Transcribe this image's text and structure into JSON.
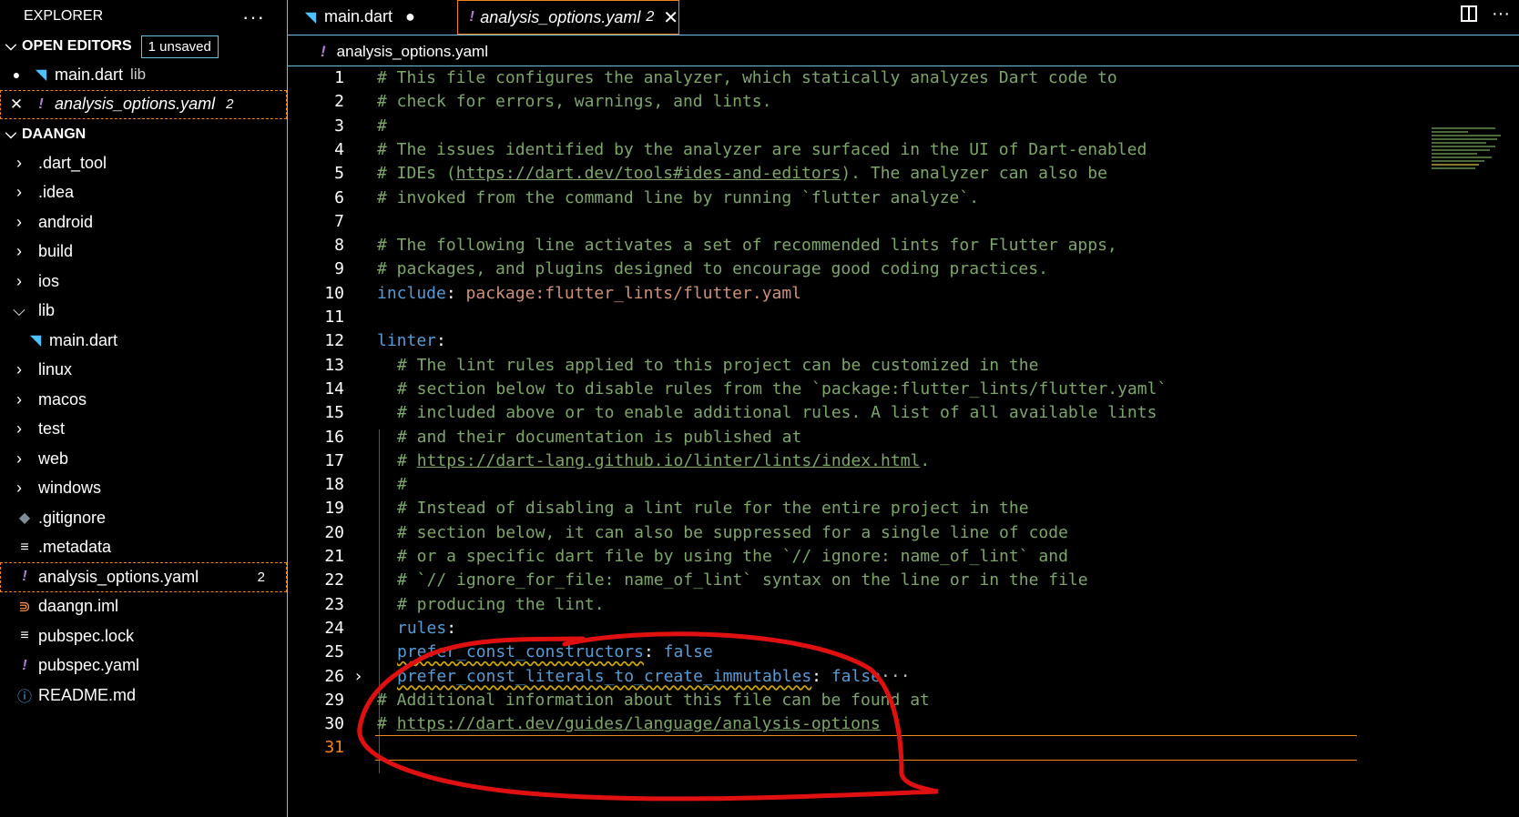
{
  "explorer": {
    "title": "EXPLORER",
    "more": "···",
    "open_editors": {
      "label": "OPEN EDITORS",
      "badge": "1 unsaved",
      "items": [
        {
          "name": "main.dart",
          "desc": "lib",
          "status": "●"
        },
        {
          "name": "analysis_options.yaml",
          "count": "2",
          "status": "✕"
        }
      ]
    },
    "project": {
      "label": "DAANGN",
      "items": [
        {
          "name": ".dart_tool"
        },
        {
          "name": ".idea"
        },
        {
          "name": "android"
        },
        {
          "name": "build"
        },
        {
          "name": "ios"
        },
        {
          "name": "lib"
        },
        {
          "name": "main.dart"
        },
        {
          "name": "linux"
        },
        {
          "name": "macos"
        },
        {
          "name": "test"
        },
        {
          "name": "web"
        },
        {
          "name": "windows"
        },
        {
          "name": ".gitignore"
        },
        {
          "name": ".metadata"
        },
        {
          "name": "analysis_options.yaml",
          "count": "2"
        },
        {
          "name": "daangn.iml"
        },
        {
          "name": "pubspec.lock"
        },
        {
          "name": "pubspec.yaml"
        },
        {
          "name": "README.md"
        }
      ]
    }
  },
  "tabs": [
    {
      "label": "main.dart",
      "modified": "●"
    },
    {
      "label": "analysis_options.yaml",
      "count": "2",
      "close": "✕"
    }
  ],
  "breadcrumb": {
    "file": "analysis_options.yaml"
  },
  "editor": {
    "line_numbers": [
      "1",
      "2",
      "3",
      "4",
      "5",
      "6",
      "7",
      "8",
      "9",
      "10",
      "11",
      "12",
      "13",
      "14",
      "15",
      "16",
      "17",
      "18",
      "19",
      "20",
      "21",
      "22",
      "23",
      "24",
      "25",
      "26",
      "29",
      "30",
      "31"
    ],
    "lines": {
      "l1": "# This file configures the analyzer, which statically analyzes Dart code to",
      "l2": "# check for errors, warnings, and lints.",
      "l3": "#",
      "l4": "# The issues identified by the analyzer are surfaced in the UI of Dart-enabled",
      "l5a": "# IDEs (",
      "l5url": "https://dart.dev/tools#ides-and-editors",
      "l5b": "). The analyzer can also be",
      "l6": "# invoked from the command line by running `flutter analyze`.",
      "l8": "# The following line activates a set of recommended lints for Flutter apps,",
      "l9": "# packages, and plugins designed to encourage good coding practices.",
      "l10key": "include",
      "l10val": "package:flutter_lints/flutter.yaml",
      "l12key": "linter",
      "l13": "# The lint rules applied to this project can be customized in the",
      "l14": "# section below to disable rules from the `package:flutter_lints/flutter.yaml`",
      "l15": "# included above or to enable additional rules. A list of all available lints",
      "l16": "# and their documentation is published at",
      "l17a": "# ",
      "l17url": "https://dart-lang.github.io/linter/lints/index.html",
      "l17b": ".",
      "l18": "#",
      "l19": "# Instead of disabling a lint rule for the entire project in the",
      "l20": "# section below, it can also be suppressed for a single line of code",
      "l21": "# or a specific dart file by using the `// ignore: name_of_lint` and",
      "l22": "# `// ignore_for_file: name_of_lint` syntax on the line or in the file",
      "l23": "# producing the lint.",
      "l24key": "rules",
      "l25key": "prefer_const_constructors",
      "l25val": "false",
      "l26key": "prefer_const_literals_to_create_immutables",
      "l26val": "false",
      "l26more": "···",
      "l29": "# Additional information about this file can be found at",
      "l30a": "# ",
      "l30url": "https://dart.dev/guides/language/analysis-options"
    }
  },
  "colors": {
    "accent_border": "#6fc3df",
    "active_outline": "#f38518",
    "annotation": "#e01010"
  }
}
